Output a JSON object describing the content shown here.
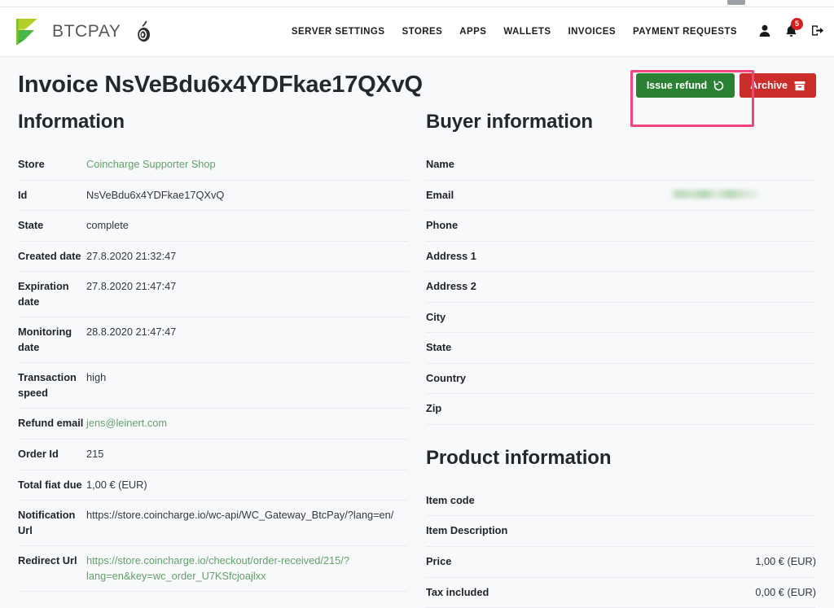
{
  "brand": {
    "word": "BTCPAY",
    "logo_icon": "btcpay-logo-icon",
    "tor_icon": "tor-onion-icon"
  },
  "nav": {
    "links": [
      {
        "label": "SERVER SETTINGS",
        "name": "nav-link-server-settings"
      },
      {
        "label": "STORES",
        "name": "nav-link-stores"
      },
      {
        "label": "APPS",
        "name": "nav-link-apps"
      },
      {
        "label": "WALLETS",
        "name": "nav-link-wallets"
      },
      {
        "label": "INVOICES",
        "name": "nav-link-invoices"
      },
      {
        "label": "PAYMENT REQUESTS",
        "name": "nav-link-payment-requests"
      }
    ],
    "icons": {
      "account": "user-icon",
      "notifications": "bell-icon",
      "logout": "sign-out-icon"
    },
    "notification_count": "5"
  },
  "header": {
    "title": "Invoice NsVeBdu6x4YDFkae17QXvQ"
  },
  "actions": {
    "issue_refund_label": "Issue refund",
    "issue_refund_icon": "refund-rotate-icon",
    "archive_label": "Archive",
    "archive_icon": "archive-box-icon"
  },
  "colors": {
    "refund_button": "#2a8133",
    "archive_button": "#cb2e2a",
    "highlight_annotation": "#f4437f",
    "link_green": "#62a06a",
    "badge_red": "#d61f1f",
    "page_background": "#f8f9fb"
  },
  "information": {
    "title": "Information",
    "rows": [
      {
        "label": "Store",
        "value": "Coincharge Supporter Shop",
        "style": "green"
      },
      {
        "label": "Id",
        "value": "NsVeBdu6x4YDFkae17QXvQ",
        "style": "plain"
      },
      {
        "label": "State",
        "value": "complete",
        "style": "plain"
      },
      {
        "label": "Created date",
        "value": "27.8.2020 21:32:47",
        "style": "plain"
      },
      {
        "label": "Expiration date",
        "value": "27.8.2020 21:47:47",
        "style": "plain"
      },
      {
        "label": "Monitoring date",
        "value": "28.8.2020 21:47:47",
        "style": "plain"
      },
      {
        "label": "Transaction speed",
        "value": "high",
        "style": "plain"
      },
      {
        "label": "Refund email",
        "value": "jens@leinert.com",
        "style": "green"
      },
      {
        "label": "Order Id",
        "value": "215",
        "style": "plain"
      },
      {
        "label": "Total fiat due",
        "value": "1,00 € (EUR)",
        "style": "plain"
      },
      {
        "label": "Notification Url",
        "value": "https://store.coincharge.io/wc-api/WC_Gateway_BtcPay/?lang=en/",
        "style": "plain"
      },
      {
        "label": "Redirect Url",
        "value": "https://store.coincharge.io/checkout/order-received/215/?lang=en&key=wc_order_U7KSfcjoajlxx",
        "style": "green"
      }
    ]
  },
  "buyer": {
    "title": "Buyer information",
    "rows": [
      {
        "label": "Name",
        "value": ""
      },
      {
        "label": "Email",
        "value": "",
        "redacted": true
      },
      {
        "label": "Phone",
        "value": ""
      },
      {
        "label": "Address 1",
        "value": ""
      },
      {
        "label": "Address 2",
        "value": ""
      },
      {
        "label": "City",
        "value": ""
      },
      {
        "label": "State",
        "value": ""
      },
      {
        "label": "Country",
        "value": ""
      },
      {
        "label": "Zip",
        "value": ""
      }
    ]
  },
  "product": {
    "title": "Product information",
    "rows": [
      {
        "label": "Item code",
        "value": ""
      },
      {
        "label": "Item Description",
        "value": ""
      },
      {
        "label": "Price",
        "value": "1,00 € (EUR)"
      },
      {
        "label": "Tax included",
        "value": "0,00 € (EUR)"
      }
    ]
  }
}
